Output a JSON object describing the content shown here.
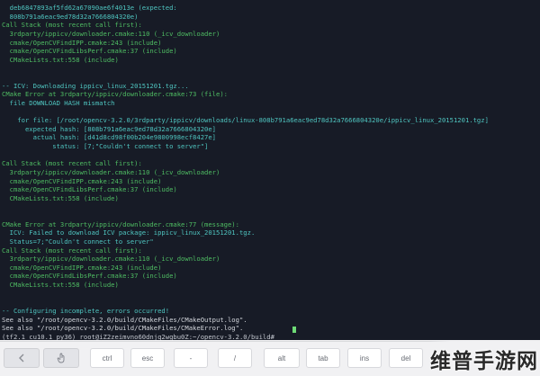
{
  "terminal": {
    "lines": [
      {
        "text": "  deb6847893af5fd62a67090ae6f4013e (expected:",
        "tone": "t"
      },
      {
        "text": "  808b791a6eac9ed78d32a7666804320e)",
        "tone": "t"
      },
      {
        "text": "Call Stack (most recent call first):",
        "tone": "g"
      },
      {
        "text": "  3rdparty/ippicv/downloader.cmake:110 (_icv_downloader)",
        "tone": "g"
      },
      {
        "text": "  cmake/OpenCVFindIPP.cmake:243 (include)",
        "tone": "g"
      },
      {
        "text": "  cmake/OpenCVFindLibsPerf.cmake:37 (include)",
        "tone": "g"
      },
      {
        "text": "  CMakeLists.txt:558 (include)",
        "tone": "g"
      },
      {
        "text": "",
        "tone": "g"
      },
      {
        "text": "",
        "tone": "g"
      },
      {
        "text": "-- ICV: Downloading ippicv_linux_20151201.tgz...",
        "tone": "t"
      },
      {
        "text": "CMake Error at 3rdparty/ippicv/downloader.cmake:73 (file):",
        "tone": "g"
      },
      {
        "text": "  file DOWNLOAD HASH mismatch",
        "tone": "t"
      },
      {
        "text": "",
        "tone": "g"
      },
      {
        "text": "    for file: [/root/opencv-3.2.0/3rdparty/ippicv/downloads/linux-808b791a6eac9ed78d32a7666804320e/ippicv_linux_20151201.tgz]",
        "tone": "t"
      },
      {
        "text": "      expected hash: [808b791a6eac9ed78d32a7666804320e]",
        "tone": "t"
      },
      {
        "text": "        actual hash: [d41d8cd98f00b204e9800998ecf8427e]",
        "tone": "t"
      },
      {
        "text": "             status: [7;\"Couldn't connect to server\"]",
        "tone": "t"
      },
      {
        "text": "",
        "tone": "g"
      },
      {
        "text": "Call Stack (most recent call first):",
        "tone": "g"
      },
      {
        "text": "  3rdparty/ippicv/downloader.cmake:110 (_icv_downloader)",
        "tone": "g"
      },
      {
        "text": "  cmake/OpenCVFindIPP.cmake:243 (include)",
        "tone": "g"
      },
      {
        "text": "  cmake/OpenCVFindLibsPerf.cmake:37 (include)",
        "tone": "g"
      },
      {
        "text": "  CMakeLists.txt:558 (include)",
        "tone": "g"
      },
      {
        "text": "",
        "tone": "g"
      },
      {
        "text": "",
        "tone": "g"
      },
      {
        "text": "CMake Error at 3rdparty/ippicv/downloader.cmake:77 (message):",
        "tone": "g"
      },
      {
        "text": "  ICV: Failed to download ICV package: ippicv_linux_20151201.tgz.",
        "tone": "t"
      },
      {
        "text": "  Status=7;\"Couldn't connect to server\"",
        "tone": "t"
      },
      {
        "text": "Call Stack (most recent call first):",
        "tone": "g"
      },
      {
        "text": "  3rdparty/ippicv/downloader.cmake:110 (_icv_downloader)",
        "tone": "g"
      },
      {
        "text": "  cmake/OpenCVFindIPP.cmake:243 (include)",
        "tone": "g"
      },
      {
        "text": "  cmake/OpenCVFindLibsPerf.cmake:37 (include)",
        "tone": "g"
      },
      {
        "text": "  CMakeLists.txt:558 (include)",
        "tone": "g"
      },
      {
        "text": "",
        "tone": "g"
      },
      {
        "text": "",
        "tone": "g"
      },
      {
        "text": "-- Configuring incomplete, errors occurred!",
        "tone": "t"
      },
      {
        "text": "See also \"/root/opencv-3.2.0/build/CMakeFiles/CMakeOutput.log\".",
        "tone": "w"
      },
      {
        "text": "See also \"/root/opencv-3.2.0/build/CMakeFiles/CMakeError.log\".",
        "tone": "w"
      },
      {
        "text": "(tf2.1_cu10.1_py36) root@iZ2zeimvno60dnjq2wgbu0Z:~/opencv-3.2.0/build# ",
        "tone": "d"
      }
    ],
    "colors": {
      "background": "#171b26",
      "green": "#4fbd63",
      "teal": "#4fc5c0",
      "white": "#d4d7dd",
      "prompt": "#c3c7cf",
      "cursor": "#6edb76"
    }
  },
  "keyboard_bar": {
    "keys": [
      {
        "name": "key-left-arrow",
        "label": "",
        "icon": "chevron-left-icon",
        "dark": true
      },
      {
        "name": "key-gesture",
        "label": "",
        "icon": "hand-pointer-icon",
        "dark": true
      },
      {
        "name": "key-ctrl",
        "label": "ctrl",
        "icon": "",
        "dark": false
      },
      {
        "name": "key-esc",
        "label": "esc",
        "icon": "",
        "dark": false
      },
      {
        "name": "key-dash",
        "label": "-",
        "icon": "",
        "dark": false
      },
      {
        "name": "key-slash",
        "label": "/",
        "icon": "",
        "dark": false
      },
      {
        "name": "key-alt",
        "label": "alt",
        "icon": "",
        "dark": false
      },
      {
        "name": "key-tab",
        "label": "tab",
        "icon": "",
        "dark": false
      },
      {
        "name": "key-ins",
        "label": "ins",
        "icon": "",
        "dark": false
      },
      {
        "name": "key-del",
        "label": "del",
        "icon": "",
        "dark": false
      }
    ]
  },
  "watermark": {
    "text": "维普手游网"
  }
}
